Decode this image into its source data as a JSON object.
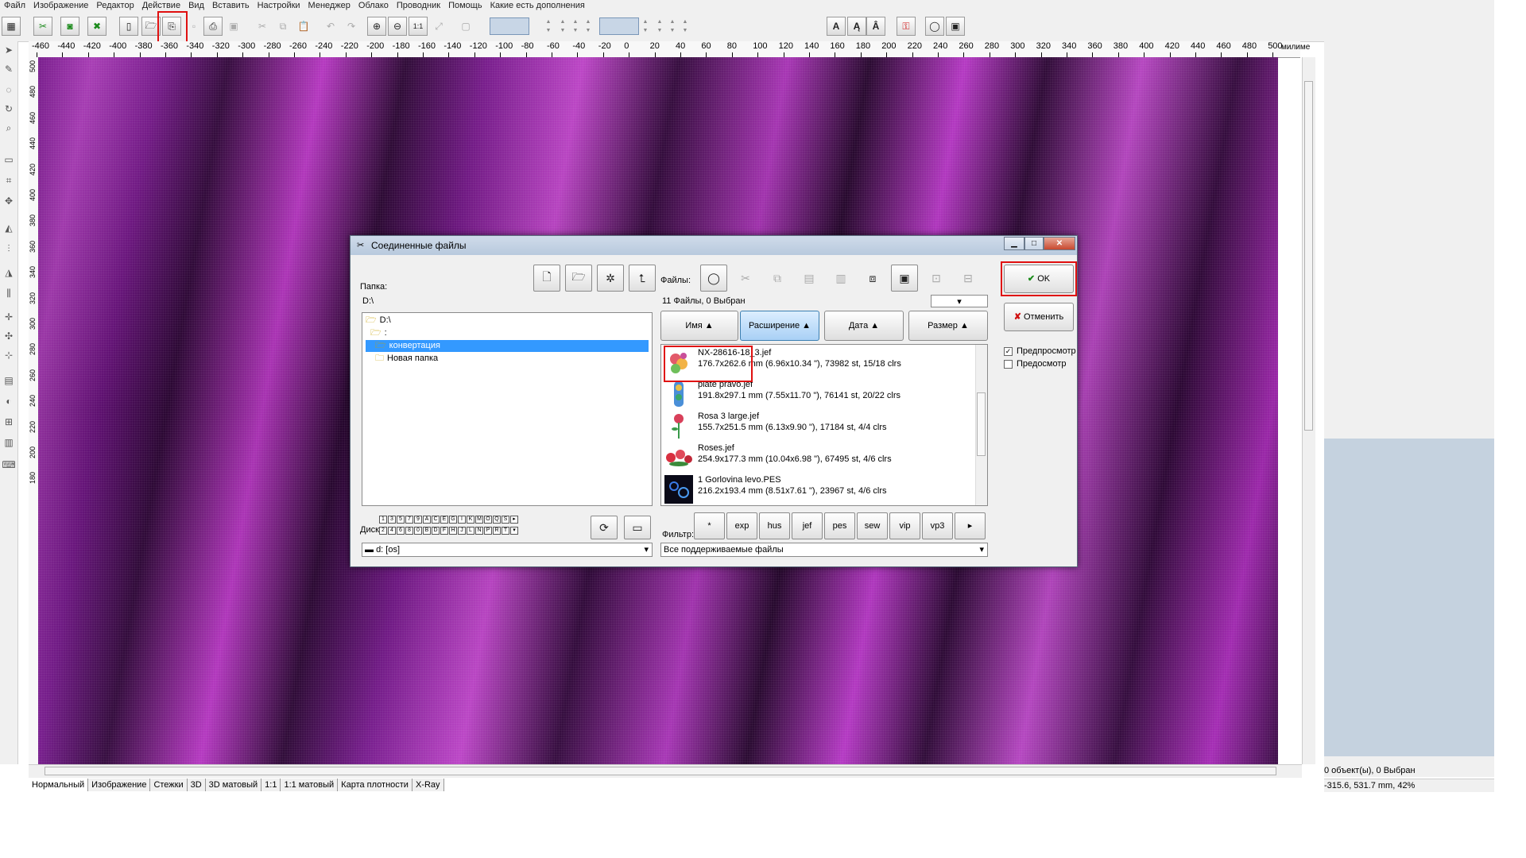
{
  "menu": [
    "Файл",
    "Изображение",
    "Редактор",
    "Действие",
    "Вид",
    "Вставить",
    "Настройки",
    "Менеджер",
    "Облако",
    "Проводник",
    "Помощь",
    "Какие есть дополнения"
  ],
  "icons": {
    "new": "new-icon",
    "open": "open-icon",
    "combine": "combine-files-icon",
    "print": "print-icon",
    "zoom_in": "zoom-in-icon",
    "zoom_out": "zoom-out-icon",
    "undo": "undo-icon",
    "redo": "redo-icon"
  },
  "ruler": {
    "h_ticks": [
      "-460",
      "-440",
      "-420",
      "-400",
      "-380",
      "-360",
      "-340",
      "-320",
      "-300",
      "-280",
      "-260",
      "-240",
      "-220",
      "-200",
      "-180",
      "-160",
      "-140",
      "-120",
      "-100",
      "-80",
      "-60",
      "-40",
      "-20",
      "0",
      "20",
      "40",
      "60",
      "80",
      "100",
      "120",
      "140",
      "160",
      "180",
      "200",
      "220",
      "240",
      "260",
      "280",
      "300",
      "320",
      "340",
      "360",
      "380",
      "400",
      "420",
      "440",
      "460",
      "480",
      "500"
    ],
    "units": "милиме",
    "v_ticks": [
      "500",
      "480",
      "460",
      "440",
      "420",
      "400",
      "380",
      "360",
      "340",
      "320",
      "300",
      "280",
      "260",
      "240",
      "220",
      "200",
      "180"
    ]
  },
  "dialog": {
    "title": "Соединенные файлы",
    "folder_label": "Папка:",
    "folder_path": "D:\\",
    "tree": [
      "D:\\",
      ":",
      "конвертация",
      "Новая папка"
    ],
    "disk_label": "Диск",
    "drive": "d: [os]",
    "files_label": "Файлы:",
    "files_count": "11 Файлы, 0 Выбран",
    "columns": [
      "Имя ▲",
      "Расширение ▲",
      "Дата ▲",
      "Размер ▲"
    ],
    "files": [
      {
        "name": "NX-28616-18_3.jef",
        "info": "176.7x262.6 mm (6.96x10.34 \"), 73982 st, 15/18 clrs"
      },
      {
        "name": "plate pravo.jef",
        "info": "191.8x297.1 mm (7.55x11.70 \"), 76141 st, 20/22 clrs"
      },
      {
        "name": "Rosa 3 large.jef",
        "info": "155.7x251.5 mm (6.13x9.90 \"), 17184 st, 4/4 clrs"
      },
      {
        "name": "Roses.jef",
        "info": "254.9x177.3 mm (10.04x6.98 \"), 67495 st, 4/6 clrs"
      },
      {
        "name": "1 Gorlovina levo.PES",
        "info": "216.2x193.4 mm (8.51x7.61 \"), 23967 st, 4/6 clrs"
      }
    ],
    "filter_label": "Фильтр:",
    "filters": [
      "*",
      "exp",
      "hus",
      "jef",
      "pes",
      "sew",
      "vip",
      "vp3",
      "▸"
    ],
    "filter_value": "Все поддерживаемые файлы",
    "ok": "OK",
    "cancel": "Отменить",
    "preview1": "Предпросмотр",
    "preview2": "Предосмотр",
    "keys_row1": [
      "1",
      "3",
      "5",
      "7",
      "9",
      "A",
      "C",
      "E",
      "G",
      "I",
      "K",
      "M",
      "O",
      "Q",
      "S",
      "▸"
    ],
    "keys_row2": [
      "2",
      "4",
      "6",
      "8",
      "0",
      "B",
      "D",
      "F",
      "H",
      "J",
      "L",
      "N",
      "P",
      "R",
      "T",
      "▾"
    ]
  },
  "tabs": [
    "Нормальный",
    "Изображение",
    "Стежки",
    "3D",
    "3D матовый",
    "1:1",
    "1:1 матовый",
    "Карта плотности",
    "X-Ray"
  ],
  "status": {
    "objects": "0 объект(ы), 0 Выбран",
    "coords": "-315.6, 531.7 mm, 42%"
  }
}
